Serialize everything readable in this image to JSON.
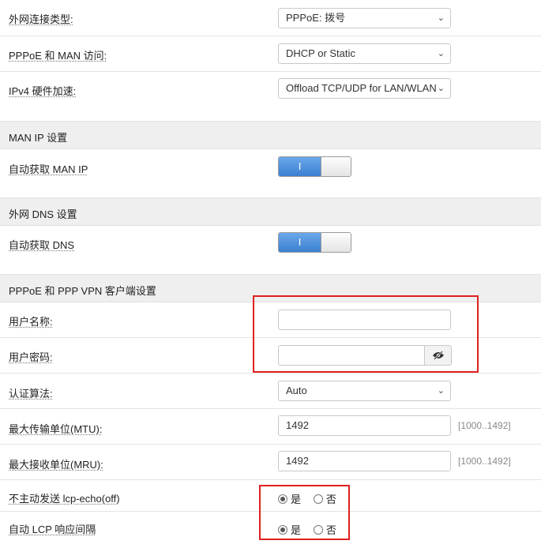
{
  "wan": {
    "connection_type": {
      "label": "外网连接类型:",
      "value": "PPPoE: 拨号"
    },
    "man_access": {
      "label": "PPPoE 和 MAN 访问:",
      "value": "DHCP or Static"
    },
    "hw_accel": {
      "label": "IPv4 硬件加速:",
      "value": "Offload TCP/UDP for LAN/WLAN"
    }
  },
  "man_ip_section": {
    "title": "MAN IP 设置",
    "auto_label": "自动获取 MAN IP",
    "toggle_on_text": "I",
    "enabled": true
  },
  "dns_section": {
    "title": "外网 DNS 设置",
    "auto_label": "自动获取 DNS",
    "toggle_on_text": "I",
    "enabled": true
  },
  "pppoe_section": {
    "title": "PPPoE 和 PPP VPN 客户端设置",
    "username": {
      "label": "用户名称:",
      "value": ""
    },
    "password": {
      "label": "用户密码:",
      "value": ""
    },
    "auth": {
      "label": "认证算法:",
      "value": "Auto"
    },
    "mtu": {
      "label": "最大传输单位(MTU):",
      "value": "1492",
      "hint": "[1000..1492]"
    },
    "mru": {
      "label": "最大接收单位(MRU):",
      "value": "1492",
      "hint": "[1000..1492]"
    },
    "lcp_echo": {
      "label": "不主动发送 lcp-echo(off)",
      "yes": "是",
      "no": "否",
      "selected": "yes"
    },
    "auto_lcp": {
      "label": "自动 LCP 响应间隔",
      "yes": "是",
      "no": "否",
      "selected": "yes"
    }
  },
  "icons": {
    "chevron": "chevron-down-icon",
    "eye": "eye-slash-icon"
  },
  "colors": {
    "accent": "#3a7fd0",
    "highlight": "#e02020"
  }
}
